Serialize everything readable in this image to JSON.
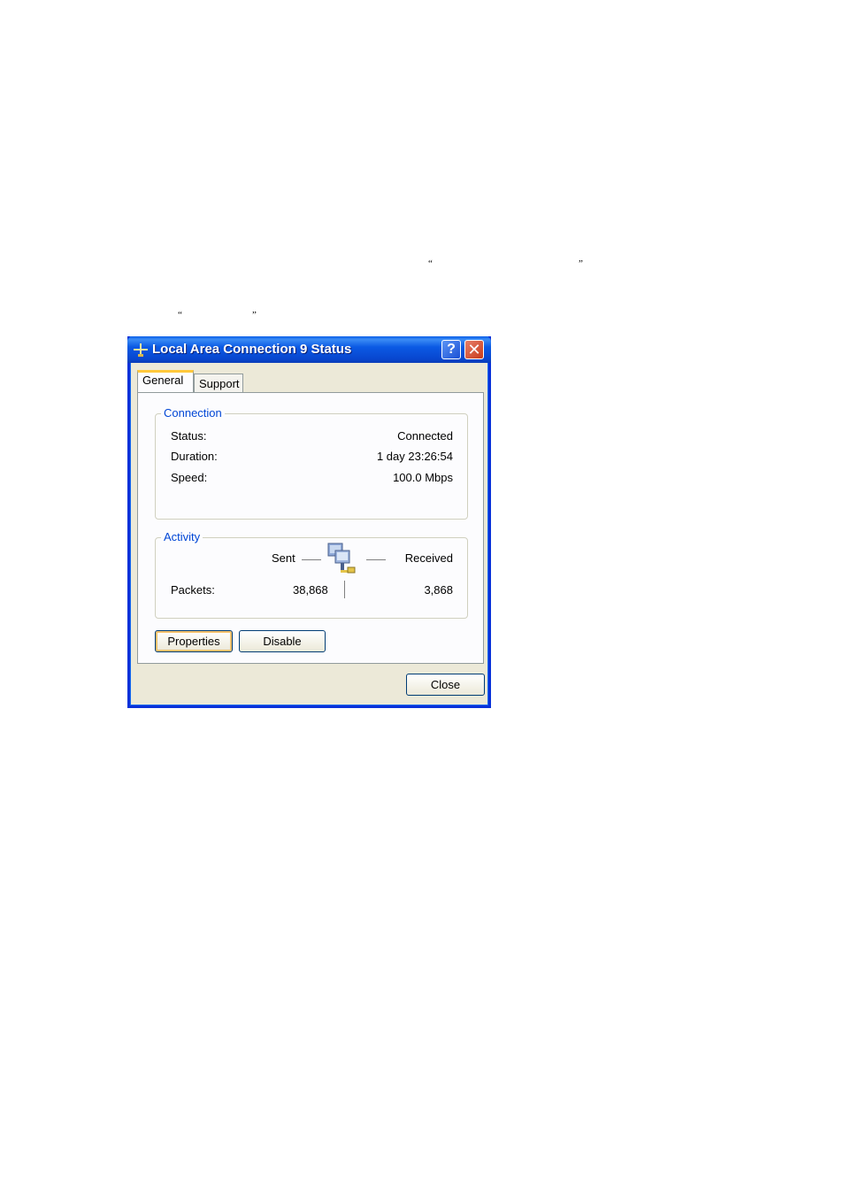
{
  "page": {
    "open_quote_1": "“",
    "close_quote_1": "”",
    "open_quote_2": "“",
    "close_quote_2": "”"
  },
  "window": {
    "title": "Local Area Connection 9 Status",
    "help_label": "?",
    "close_label": "✕",
    "icon": "network-connection-icon"
  },
  "tabs": [
    {
      "label": "General",
      "active": true
    },
    {
      "label": "Support",
      "active": false
    }
  ],
  "connection": {
    "legend": "Connection",
    "rows": [
      {
        "label": "Status:",
        "value": "Connected"
      },
      {
        "label": "Duration:",
        "value": "1 day 23:26:54"
      },
      {
        "label": "Speed:",
        "value": "100.0 Mbps"
      }
    ]
  },
  "activity": {
    "legend": "Activity",
    "sent_label": "Sent",
    "received_label": "Received",
    "packets_label": "Packets:",
    "packets_sent": "38,868",
    "packets_received": "3,868",
    "icon": "network-activity-icon"
  },
  "buttons": {
    "properties": "Properties",
    "disable": "Disable",
    "close": "Close"
  },
  "colors": {
    "titlebar": "#0a5ee8",
    "group_legend": "#0046d5",
    "tab_highlight": "#ffc83c",
    "close_button": "#c73b1b"
  }
}
